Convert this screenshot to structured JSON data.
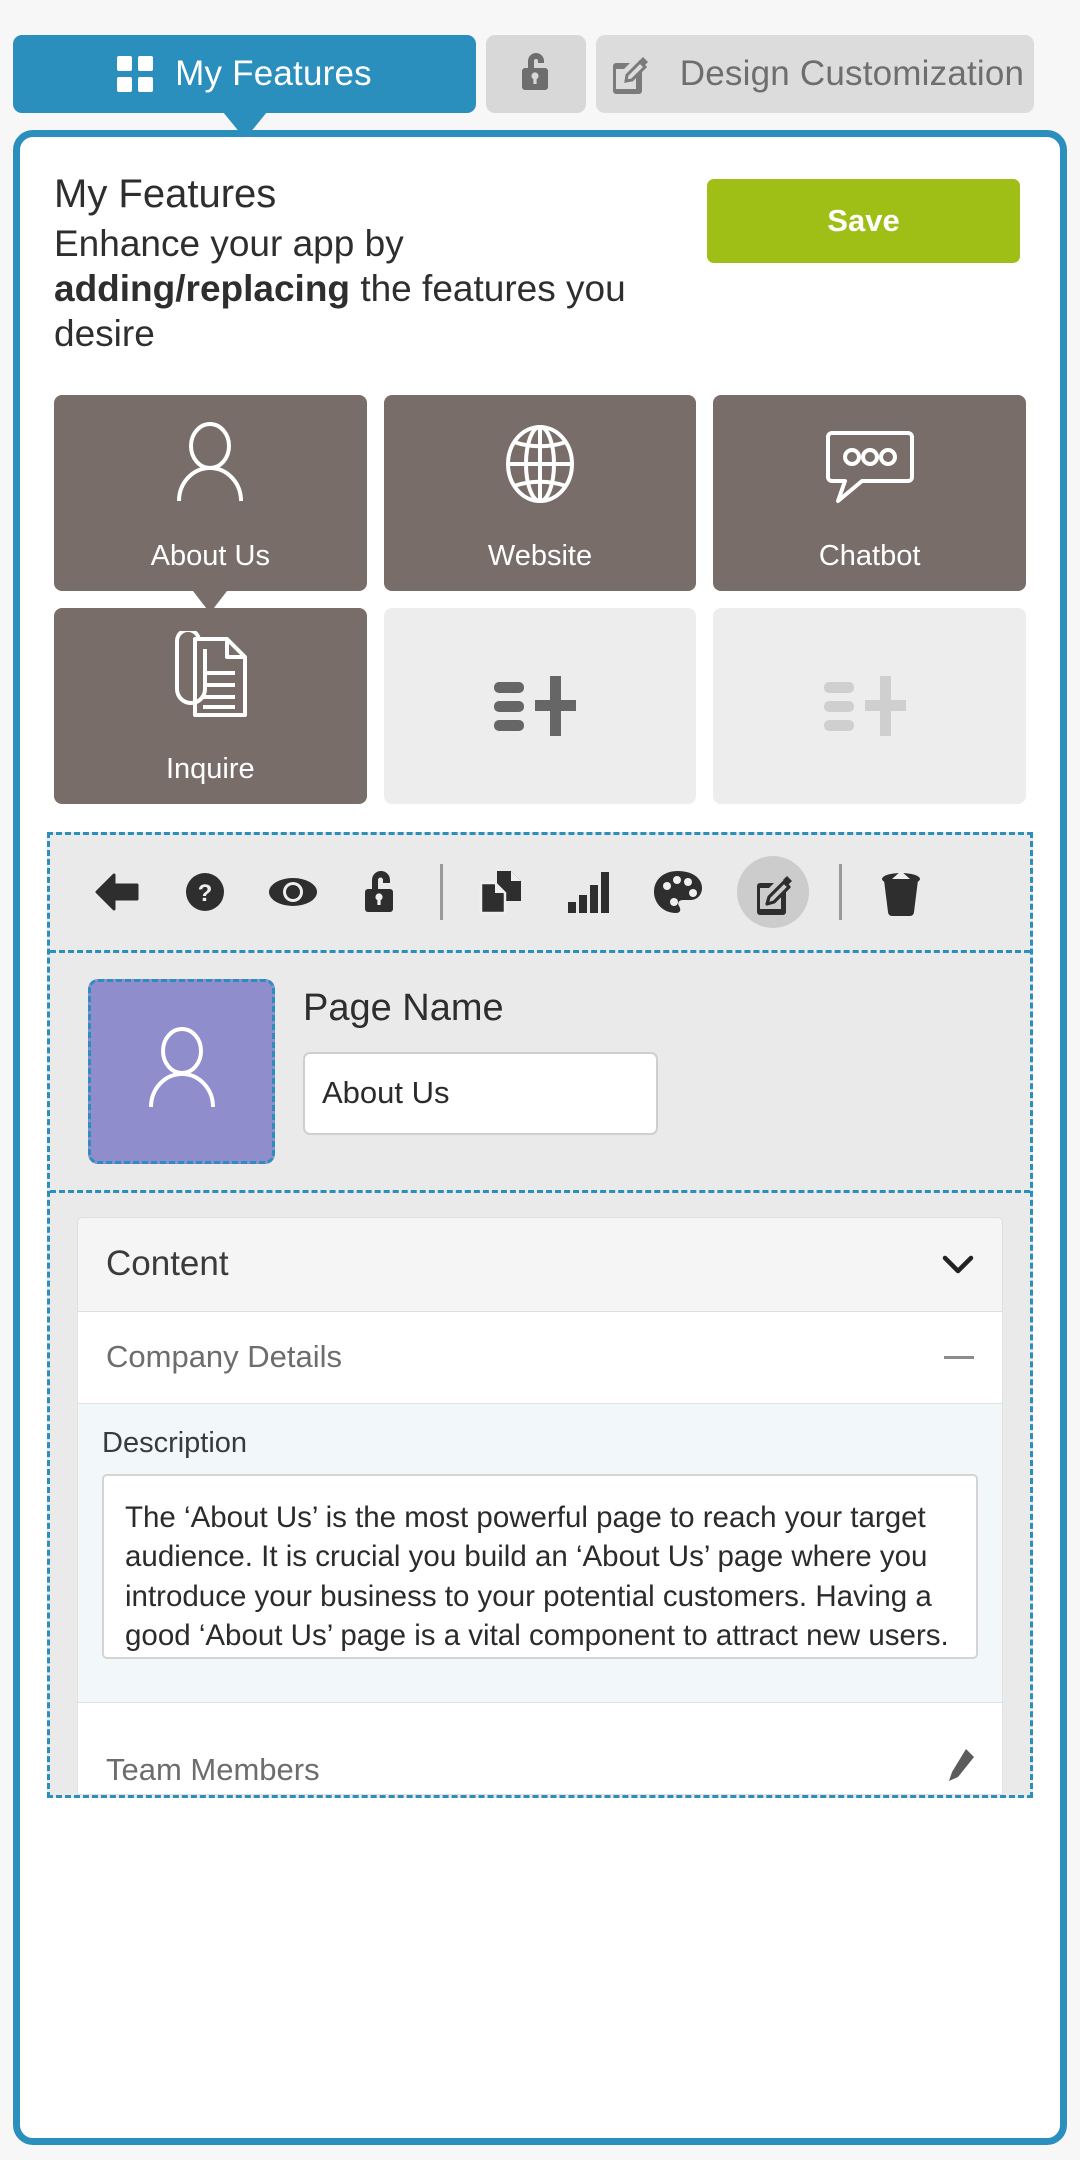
{
  "tabs": [
    {
      "id": "my-features",
      "label": "My Features",
      "icon": "grid-icon",
      "active": true
    },
    {
      "id": "lock",
      "label": "",
      "icon": "lock-icon",
      "active": false
    },
    {
      "id": "design-customization",
      "label": "Design Customization",
      "icon": "edit-square-icon",
      "active": false
    }
  ],
  "header": {
    "title": "My Features",
    "subtitle_part1": "Enhance your app by ",
    "subtitle_bold": "adding/replacing",
    "subtitle_part2": " the features you desire",
    "save_label": "Save"
  },
  "features": [
    {
      "label": "About Us",
      "icon": "person-icon",
      "state": "filled",
      "selected": true
    },
    {
      "label": "Website",
      "icon": "globe-icon",
      "state": "filled",
      "selected": false
    },
    {
      "label": "Chatbot",
      "icon": "chat-bubble-icon",
      "state": "filled",
      "selected": false
    },
    {
      "label": "Inquire",
      "icon": "document-clip-icon",
      "state": "filled",
      "selected": false
    },
    {
      "label": "",
      "icon": "add-feature-icon",
      "state": "empty",
      "selected": false
    },
    {
      "label": "",
      "icon": "add-feature-icon",
      "state": "empty-faded",
      "selected": false
    }
  ],
  "toolbar": [
    {
      "id": "back",
      "icon": "back-arrow-icon",
      "active": false
    },
    {
      "id": "help",
      "icon": "question-circle-icon",
      "active": false
    },
    {
      "id": "preview",
      "icon": "eye-icon",
      "active": false
    },
    {
      "id": "lock",
      "icon": "lock-open-icon",
      "active": false
    },
    {
      "id": "separator-1",
      "icon": "separator",
      "active": false
    },
    {
      "id": "duplicate",
      "icon": "copy-pages-icon",
      "active": false
    },
    {
      "id": "statistics",
      "icon": "bar-chart-icon",
      "active": false
    },
    {
      "id": "theme",
      "icon": "palette-icon",
      "active": false
    },
    {
      "id": "edit",
      "icon": "edit-square-icon",
      "active": true
    },
    {
      "id": "separator-2",
      "icon": "separator",
      "active": false
    },
    {
      "id": "delete",
      "icon": "trash-icon",
      "active": false
    }
  ],
  "page_editor": {
    "thumb_icon": "person-icon",
    "thumb_color": "#8f8dcc",
    "page_name_label": "Page Name",
    "page_name_value": "About Us",
    "page_name_placeholder": "Page Name"
  },
  "content_panel": {
    "header_label": "Content",
    "header_chevron": "chevron-down-icon",
    "sections": [
      {
        "label": "Company Details",
        "toggle": "minus-icon",
        "expanded": true,
        "fields": [
          {
            "label": "Description",
            "type": "textarea",
            "value": "The ‘About Us’ is the most powerful page to reach your target audience. It is crucial you build an ‘About Us’ page where you introduce your business to your potential customers. Having a good ‘About Us’ page is a vital component to attract new users.",
            "placeholder": "Description"
          }
        ]
      },
      {
        "label": "Team Members",
        "toggle": "pencil-icon",
        "expanded": false,
        "fields": []
      }
    ]
  },
  "colors": {
    "accent_blue": "#2a8fbd",
    "save_green": "#9fbe16",
    "tile_filled": "#786d69",
    "tile_empty": "#ededed",
    "thumb_purple": "#8f8dcc"
  }
}
